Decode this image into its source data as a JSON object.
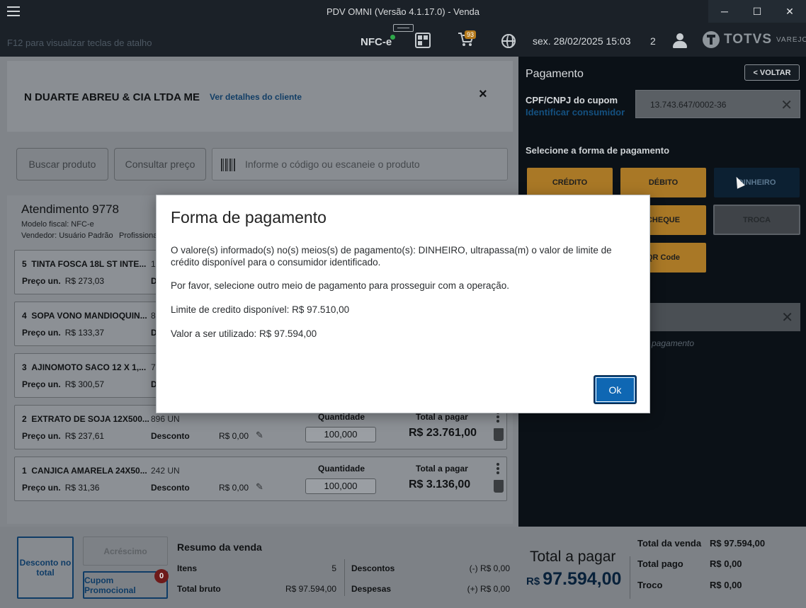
{
  "window": {
    "title": "PDV OMNI (Versão 4.1.17.0) - Venda",
    "minimize": "─",
    "maximize": "☐",
    "close": "✕"
  },
  "header": {
    "hint": "F12 para visualizar teclas de atalho",
    "doc_type": "NFC-e",
    "cart_count": "93",
    "datetime": "sex. 28/02/2025 15:03",
    "count": "2",
    "logo_brand": "TOTVS",
    "logo_sub": "VAREJO"
  },
  "customer": {
    "name": "N DUARTE ABREU & CIA LTDA ME",
    "details_link": "Ver detalhes do cliente",
    "close": "×"
  },
  "search": {
    "buscar_label": "Buscar produto",
    "consultar_label": "Consultar preço",
    "placeholder": "Informe o código ou escaneie o produto"
  },
  "atendimento": {
    "title": "Atendimento 9778",
    "modelo": "Modelo fiscal: NFC-e",
    "vendedor": "Vendedor: Usuário Padrão",
    "profissional": "Profissional",
    "price_label": "Preço un.",
    "desc_label": "Desconto",
    "qty_label": "Quantidade",
    "total_label": "Total a pagar",
    "items": [
      {
        "idx": "5",
        "name": "TINTA FOSCA 18L ST INTE...",
        "qty_code": "1",
        "price": "R$ 273,03",
        "desc_short": "D"
      },
      {
        "idx": "4",
        "name": "SOPA VONO MANDIOQUIN...",
        "qty_code": "8",
        "price": "R$ 133,37",
        "desc_short": "D"
      },
      {
        "idx": "3",
        "name": "AJINOMOTO SACO 12 X 1,...",
        "qty_code": "7",
        "price": "R$ 300,57",
        "desc_short": "D"
      },
      {
        "idx": "2",
        "name": "EXTRATO DE SOJA 12X500...",
        "qty_code": "896  UN",
        "price": "R$ 237,61",
        "discount": "R$ 0,00",
        "quantity": "100,000",
        "total": "R$ 23.761,00"
      },
      {
        "idx": "1",
        "name": "CANJICA AMARELA 24X50...",
        "qty_code": "242  UN",
        "price": "R$ 31,36",
        "discount": "R$ 0,00",
        "quantity": "100,000",
        "total": "R$ 3.136,00"
      }
    ]
  },
  "payment": {
    "title": "Pagamento",
    "back_label": "< VOLTAR",
    "cpf_label": "CPF/CNPJ do cupom",
    "identify_link": "Identificar consumidor",
    "cpf_value": "13.743.647/0002-36",
    "select_label": "Selecione a forma de pagamento",
    "methods": {
      "credito": "CRÉDITO",
      "debito": "DÉBITO",
      "dinheiro": "DINHEIRO",
      "cheque": "CHEQUE",
      "troca": "TROCA",
      "qrcode": "QR Code"
    },
    "note": "o pagamento"
  },
  "summary": {
    "desconto_total": "Desconto no total",
    "acrescimo": "Acréscimo",
    "cupom": "Cupom Promocional",
    "cupom_badge": "0",
    "resumo_title": "Resumo da venda",
    "itens_label": "Itens",
    "itens_value": "5",
    "bruto_label": "Total bruto",
    "bruto_value": "R$ 97.594,00",
    "descontos_label": "Descontos",
    "descontos_value": "(-) R$ 0,00",
    "despesas_label": "Despesas",
    "despesas_value": "(+) R$ 0,00",
    "total_pagar_label": "Total a pagar",
    "total_pagar_currency": "R$",
    "total_pagar_value": "97.594,00",
    "total_venda_label": "Total da venda",
    "total_venda_value": "R$ 97.594,00",
    "total_pago_label": "Total pago",
    "total_pago_value": "R$ 0,00",
    "troco_label": "Troco",
    "troco_value": "R$ 0,00"
  },
  "modal": {
    "title": "Forma de pagamento",
    "p1": "O valore(s) informado(s) no(s) meios(s) de pagamento(s): DINHEIRO, ultrapassa(m) o valor de limite de crédito disponível para o consumidor identificado.",
    "p2": "Por favor, selecione outro meio de pagamento para prosseguir com a operação.",
    "p3": "Limite de credito disponível: R$ 97.510,00",
    "p4": "Valor a ser utilizado: R$ 97.594,00",
    "ok_label": "Ok"
  }
}
